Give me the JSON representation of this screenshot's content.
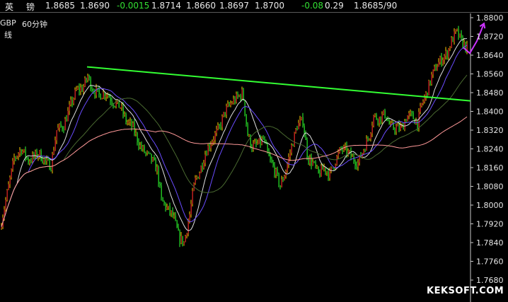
{
  "quote_bar": {
    "name_chars": [
      "英",
      "镑"
    ],
    "fields": [
      "1.8685",
      "1.8690",
      "-0.0015",
      "1.8714",
      "1.8660",
      "1.8697",
      "1.8700",
      "-0.08",
      "0.29",
      "1.8685/90"
    ],
    "negative_color": "#33e033",
    "text_color": "#e8e8e8"
  },
  "chart_label": {
    "symbol_partial": "GBP",
    "period": "60分钟",
    "line_type_partial": "线"
  },
  "watermark": "KEKSOFT.COM",
  "chart_data": {
    "type": "candlestick",
    "ylim": [
      1.766,
      1.883
    ],
    "y_ticks": [
      "1.8800",
      "1.8720",
      "1.8640",
      "1.8560",
      "1.8480",
      "1.8400",
      "1.8320",
      "1.8240",
      "1.8160",
      "1.8080",
      "1.8000",
      "1.7920",
      "1.7840",
      "1.7760",
      "1.7680"
    ],
    "price_path": [
      [
        0,
        1.79
      ],
      [
        10,
        1.805
      ],
      [
        20,
        1.82
      ],
      [
        30,
        1.824
      ],
      [
        40,
        1.819
      ],
      [
        55,
        1.822
      ],
      [
        65,
        1.818
      ],
      [
        72,
        1.817
      ],
      [
        80,
        1.832
      ],
      [
        90,
        1.834
      ],
      [
        100,
        1.843
      ],
      [
        108,
        1.849
      ],
      [
        117,
        1.85
      ],
      [
        124,
        1.855
      ],
      [
        130,
        1.85
      ],
      [
        140,
        1.847
      ],
      [
        150,
        1.848
      ],
      [
        160,
        1.844
      ],
      [
        170,
        1.842
      ],
      [
        178,
        1.836
      ],
      [
        188,
        1.833
      ],
      [
        198,
        1.825
      ],
      [
        206,
        1.822
      ],
      [
        215,
        1.819
      ],
      [
        222,
        1.815
      ],
      [
        228,
        1.802
      ],
      [
        235,
        1.799
      ],
      [
        245,
        1.795
      ],
      [
        253,
        1.786
      ],
      [
        260,
        1.784
      ],
      [
        268,
        1.796
      ],
      [
        275,
        1.81
      ],
      [
        283,
        1.815
      ],
      [
        291,
        1.823
      ],
      [
        300,
        1.828
      ],
      [
        310,
        1.833
      ],
      [
        318,
        1.84
      ],
      [
        328,
        1.844
      ],
      [
        336,
        1.846
      ],
      [
        343,
        1.848
      ],
      [
        350,
        1.83
      ],
      [
        356,
        1.825
      ],
      [
        365,
        1.826
      ],
      [
        372,
        1.828
      ],
      [
        380,
        1.82
      ],
      [
        388,
        1.815
      ],
      [
        396,
        1.808
      ],
      [
        404,
        1.815
      ],
      [
        412,
        1.825
      ],
      [
        420,
        1.834
      ],
      [
        428,
        1.836
      ],
      [
        435,
        1.82
      ],
      [
        442,
        1.818
      ],
      [
        450,
        1.813
      ],
      [
        458,
        1.816
      ],
      [
        466,
        1.813
      ],
      [
        474,
        1.819
      ],
      [
        482,
        1.824
      ],
      [
        490,
        1.823
      ],
      [
        498,
        1.82
      ],
      [
        506,
        1.818
      ],
      [
        514,
        1.824
      ],
      [
        522,
        1.83
      ],
      [
        528,
        1.838
      ],
      [
        536,
        1.837
      ],
      [
        544,
        1.839
      ],
      [
        552,
        1.833
      ],
      [
        560,
        1.833
      ],
      [
        568,
        1.833
      ],
      [
        575,
        1.838
      ],
      [
        582,
        1.838
      ],
      [
        590,
        1.835
      ],
      [
        596,
        1.843
      ],
      [
        602,
        1.847
      ],
      [
        610,
        1.855
      ],
      [
        618,
        1.86
      ],
      [
        626,
        1.863
      ],
      [
        632,
        1.865
      ],
      [
        638,
        1.87
      ],
      [
        645,
        1.874
      ],
      [
        652,
        1.87
      ],
      [
        660,
        1.867
      ]
    ],
    "ma_short_color": "#e0e0e0",
    "ma_mid_color": "#6a4cff",
    "ma_long_color": "#4a6a30",
    "ma_slow_color": "#ff9999",
    "trendline": {
      "from": [
        123,
        1.859
      ],
      "to": [
        665,
        1.8445
      ],
      "color": "#33ff33"
    },
    "projection": {
      "points": [
        [
          655,
          1.8672
        ],
        [
          664,
          1.8648
        ],
        [
          674,
          1.87
        ],
        [
          684,
          1.8775
        ]
      ],
      "color": "#cc33ff"
    }
  }
}
